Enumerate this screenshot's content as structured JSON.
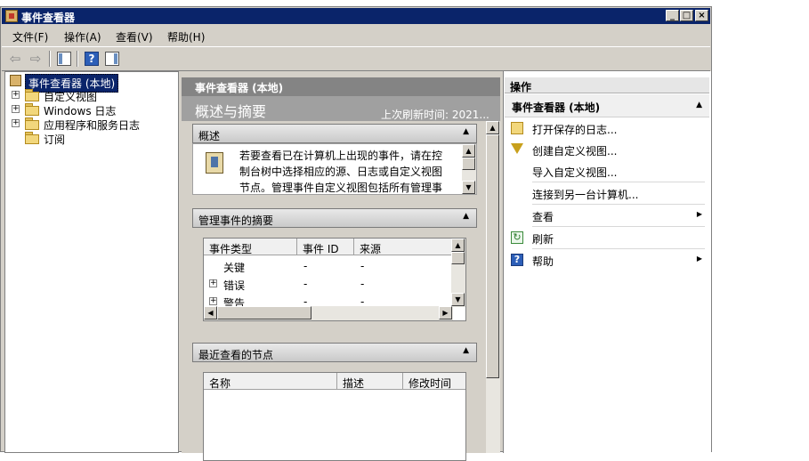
{
  "window": {
    "title": "事件查看器"
  },
  "menu": [
    {
      "label": "文件(F)"
    },
    {
      "label": "操作(A)"
    },
    {
      "label": "查看(V)"
    },
    {
      "label": "帮助(H)"
    }
  ],
  "tree": [
    {
      "label": "事件查看器 (本地)",
      "selected": true,
      "expander": ""
    },
    {
      "label": "自定义视图",
      "expander": "+"
    },
    {
      "label": "Windows 日志",
      "expander": "+"
    },
    {
      "label": "应用程序和服务日志",
      "expander": "+"
    },
    {
      "label": "订阅",
      "expander": ""
    }
  ],
  "center": {
    "header": "事件查看器 (本地)",
    "subtitle": "概述与摘要",
    "last_refresh": "上次刷新时间: 2021...",
    "overview": {
      "heading": "概述",
      "text_lines": [
        "若要查看已在计算机上出现的事件，请在控",
        "制台树中选择相应的源、日志或自定义视图",
        "节点。管理事件自定义视图包括所有管理事"
      ]
    },
    "summary": {
      "heading": "管理事件的摘要",
      "columns": [
        "事件类型",
        "事件 ID",
        "来源"
      ],
      "rows": [
        {
          "type": "关键",
          "id": "-",
          "source": "-",
          "expander": ""
        },
        {
          "type": "错误",
          "id": "-",
          "source": "-",
          "expander": "+"
        },
        {
          "type": "警告",
          "id": "-",
          "source": "-",
          "expander": "+"
        }
      ]
    },
    "recent": {
      "heading": "最近查看的节点",
      "columns": [
        "名称",
        "描述",
        "修改时间"
      ]
    }
  },
  "actions": {
    "header": "操作",
    "group": "事件查看器 (本地)",
    "items": [
      {
        "label": "打开保存的日志...",
        "icon": "open-log-icon",
        "submenu": false
      },
      {
        "label": "创建自定义视图...",
        "icon": "filter-icon",
        "submenu": false
      },
      {
        "label": "导入自定义视图...",
        "icon": "",
        "submenu": false
      },
      {
        "label": "连接到另一台计算机...",
        "icon": "",
        "submenu": false
      },
      {
        "label": "查看",
        "icon": "",
        "submenu": true
      },
      {
        "label": "刷新",
        "icon": "refresh-icon",
        "submenu": false
      },
      {
        "label": "帮助",
        "icon": "help-icon",
        "submenu": true
      }
    ]
  }
}
